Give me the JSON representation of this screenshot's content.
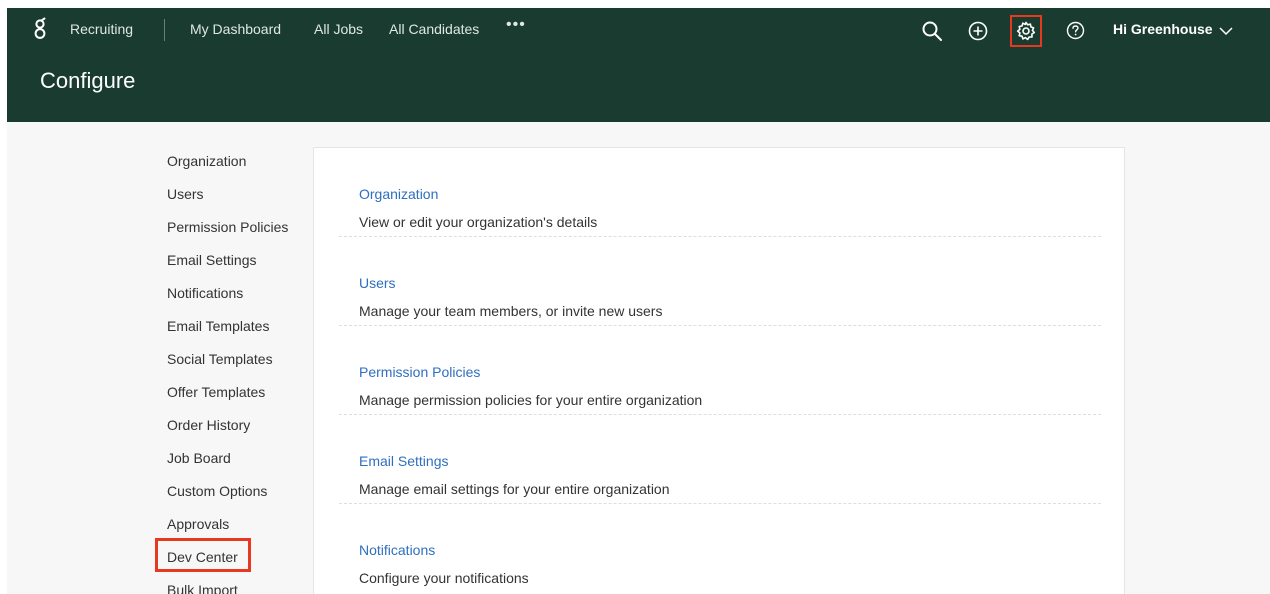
{
  "topbar": {
    "logo_icon": "greenhouse-logo-icon",
    "app_label": "Recruiting",
    "nav": [
      "My Dashboard",
      "All Jobs",
      "All Candidates"
    ],
    "more_label": "•••",
    "icons": [
      "search-icon",
      "plus-circle-icon",
      "gear-icon",
      "help-icon"
    ],
    "user_label": "Hi Greenhouse",
    "highlight_color": "#e6391f"
  },
  "header": {
    "title": "Configure",
    "background": "#1a3c30"
  },
  "sidebar": {
    "items": [
      "Organization",
      "Users",
      "Permission Policies",
      "Email Settings",
      "Notifications",
      "Email Templates",
      "Social Templates",
      "Offer Templates",
      "Order History",
      "Job Board",
      "Custom Options",
      "Approvals",
      "Dev Center",
      "Bulk Import"
    ]
  },
  "main": {
    "sections": [
      {
        "title": "Organization",
        "desc": "View or edit your organization's details"
      },
      {
        "title": "Users",
        "desc": "Manage your team members, or invite new users"
      },
      {
        "title": "Permission Policies",
        "desc": "Manage permission policies for your entire organization"
      },
      {
        "title": "Email Settings",
        "desc": "Manage email settings for your entire organization"
      },
      {
        "title": "Notifications",
        "desc": "Configure your notifications"
      }
    ],
    "link_color": "#2f6fbf"
  }
}
